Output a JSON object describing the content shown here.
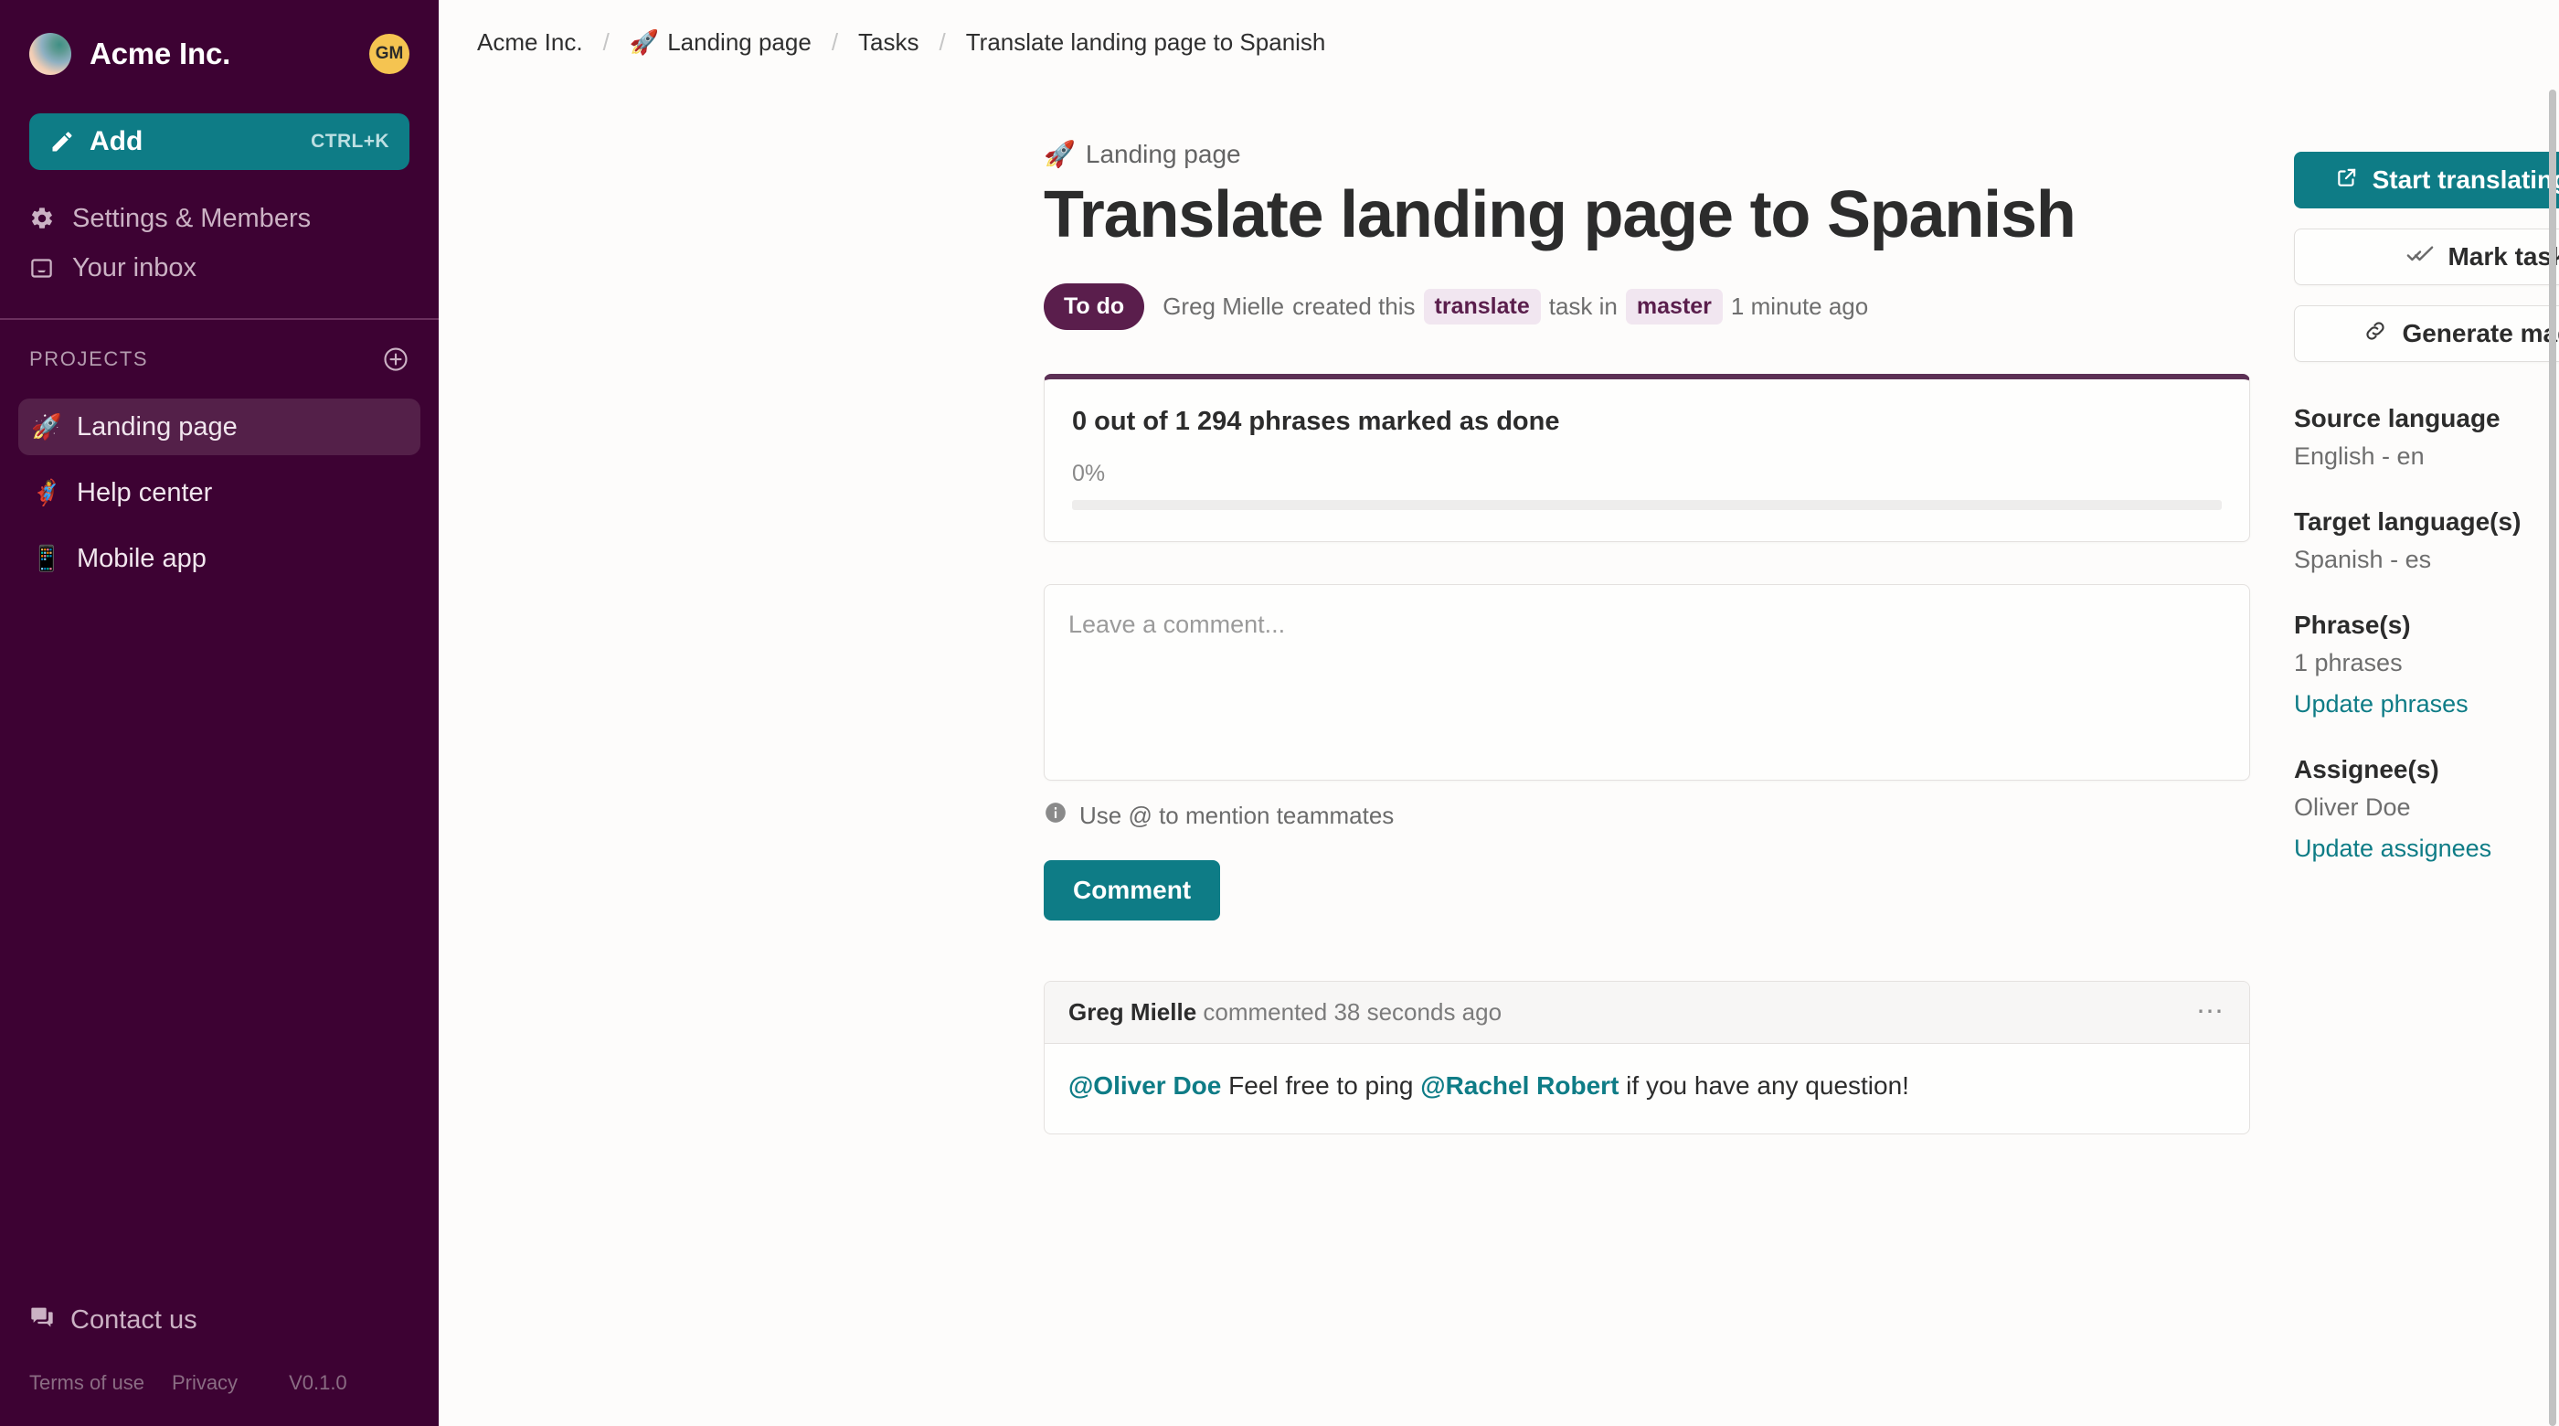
{
  "sidebar": {
    "brand": {
      "name": "Acme Inc.",
      "avatar_initials": "GM",
      "avatar_color": "#f5c451"
    },
    "add_button": {
      "label": "Add",
      "shortcut": "CTRL+K"
    },
    "nav": [
      {
        "label": "Settings & Members",
        "icon": "gear-icon"
      },
      {
        "label": "Your inbox",
        "icon": "inbox-icon"
      }
    ],
    "projects_header": {
      "label": "PROJECTS",
      "add_icon": "plus-circle-icon"
    },
    "projects": [
      {
        "emoji": "🚀",
        "label": "Landing page",
        "active": true
      },
      {
        "emoji": "🦸‍♀️",
        "label": "Help center",
        "active": false
      },
      {
        "emoji": "📱",
        "label": "Mobile app",
        "active": false
      }
    ],
    "contact": {
      "label": "Contact us",
      "icon": "chat-icon"
    },
    "legal": {
      "terms": "Terms of use",
      "privacy": "Privacy",
      "version": "V0.1.0"
    }
  },
  "breadcrumb": {
    "org": "Acme Inc.",
    "project_emoji": "🚀",
    "project": "Landing page",
    "section": "Tasks",
    "current": "Translate landing page to Spanish",
    "separator": "/"
  },
  "task": {
    "kicker_emoji": "🚀",
    "kicker": "Landing page",
    "title": "Translate landing page to Spanish",
    "status": "To do",
    "meta_author": "Greg Mielle",
    "meta_created": "created this",
    "meta_type_tag": "translate",
    "meta_task_in": "task in",
    "meta_branch_tag": "master",
    "meta_time": "1 minute ago"
  },
  "progress": {
    "title": "0 out of 1 294 phrases marked as done",
    "percent_label": "0%",
    "percent_value": 0,
    "done": 0,
    "total": 1294,
    "accent_color": "#5c3055"
  },
  "comment_form": {
    "placeholder": "Leave a comment...",
    "value": "",
    "hint": "Use @ to mention teammates",
    "submit_label": "Comment"
  },
  "comments": [
    {
      "author": "Greg Mielle",
      "action": "commented 38 seconds ago",
      "menu_icon": "ellipsis-icon",
      "body_parts": [
        {
          "type": "mention",
          "text": "@Oliver Doe"
        },
        {
          "type": "text",
          "text": " Feel free to ping "
        },
        {
          "type": "mention",
          "text": "@Rachel Robert"
        },
        {
          "type": "text",
          "text": " if you have any question!"
        }
      ]
    }
  ],
  "side_panel": {
    "buttons": [
      {
        "label": "Start translating phrases",
        "icon": "open-in-new-icon",
        "style": "primary"
      },
      {
        "label": "Mark task as",
        "icon": "done-all-icon",
        "style": "ghost"
      },
      {
        "label": "Generate magic link",
        "icon": "link-icon",
        "style": "ghost"
      }
    ],
    "fields": [
      {
        "label": "Source language",
        "value": "English - en",
        "link": null
      },
      {
        "label": "Target language(s)",
        "value": "Spanish - es",
        "link": null
      },
      {
        "label": "Phrase(s)",
        "value": "1 phrases",
        "link": "Update phrases"
      },
      {
        "label": "Assignee(s)",
        "value": "Oliver Doe",
        "link": "Update assignees"
      }
    ]
  },
  "theme": {
    "sidebar_bg": "#3d0233",
    "accent_teal": "#0e7c86",
    "accent_purple": "#5a1e4c",
    "page_bg": "#fdfcfb"
  }
}
